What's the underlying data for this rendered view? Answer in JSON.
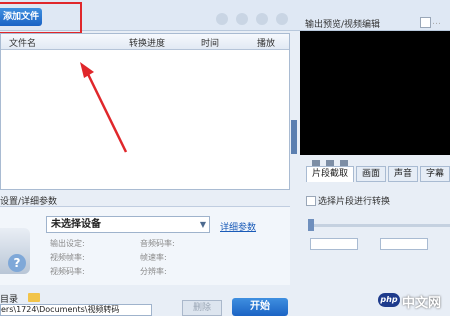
{
  "toolbar": {
    "add_file_label": "添加文件"
  },
  "file_list": {
    "columns": [
      "文件名",
      "转换进度",
      "时间",
      "播放"
    ]
  },
  "settings": {
    "title": "设置/详细参数",
    "device_value": "未选择设备",
    "advanced_link": "详细参数",
    "params": [
      "输出设定:",
      "音频码率:",
      "视频帧率:",
      "帧速率:",
      "视频码率:",
      "分辨率:"
    ]
  },
  "output": {
    "label": "目录",
    "path": "ers\\1724\\Documents\\视频转码",
    "delete_label": "删除",
    "start_label": "开始"
  },
  "preview": {
    "title": "输出预览/视频编辑",
    "tabs": [
      "片段截取",
      "画面",
      "声音",
      "字幕"
    ],
    "clip_checkbox_label": "选择片段进行转换"
  },
  "watermark": {
    "logo": "php",
    "text": "中文网"
  },
  "colors": {
    "accent": "#1b63c4",
    "highlight": "#e0272b"
  },
  "icons": [
    "folder-icon",
    "dropdown-icon",
    "question-icon"
  ]
}
